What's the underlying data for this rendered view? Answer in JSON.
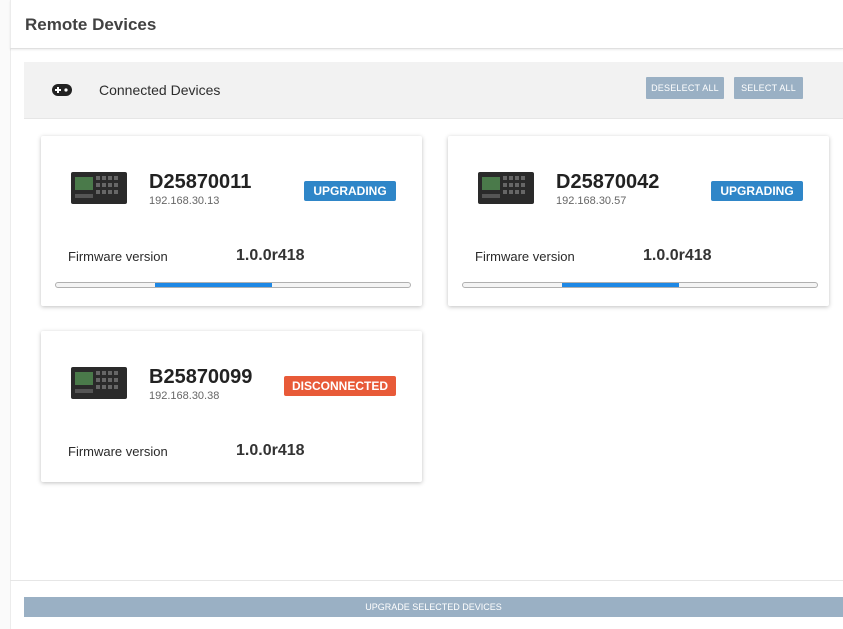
{
  "header": {
    "title": "Remote Devices"
  },
  "toolbar": {
    "icon": "gamepad-icon",
    "title": "Connected Devices",
    "deselect_label": "DESELECT ALL",
    "select_label": "SELECT ALL"
  },
  "devices": [
    {
      "name": "D25870011",
      "ip": "192.168.30.13",
      "status": "UPGRADING",
      "status_color": "#2f86c8",
      "fw_label": "Firmware version",
      "fw_value": "1.0.0r418",
      "progress_start": 0.28,
      "progress_end": 0.61
    },
    {
      "name": "D25870042",
      "ip": "192.168.30.57",
      "status": "UPGRADING",
      "status_color": "#2f86c8",
      "fw_label": "Firmware version",
      "fw_value": "1.0.0r418",
      "progress_start": 0.28,
      "progress_end": 0.61
    },
    {
      "name": "B25870099",
      "ip": "192.168.30.38",
      "status": "DISCONNECTED",
      "status_color": "#e85a38",
      "fw_label": "Firmware version",
      "fw_value": "1.0.0r418"
    }
  ],
  "footer": {
    "upgrade_label": "UPGRADE SELECTED DEVICES"
  }
}
